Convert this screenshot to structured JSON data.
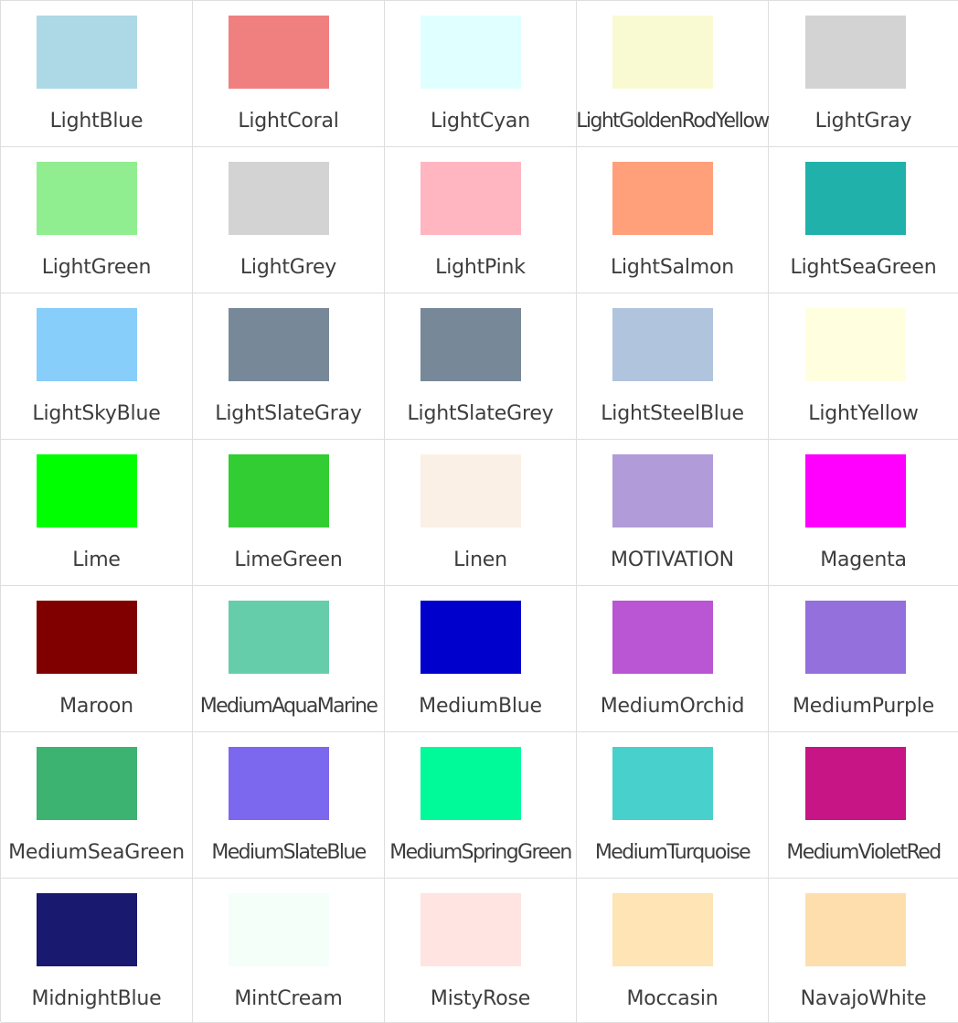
{
  "colors": [
    {
      "name": "LightBlue",
      "hex": "#ADD8E6"
    },
    {
      "name": "LightCoral",
      "hex": "#F08080"
    },
    {
      "name": "LightCyan",
      "hex": "#E0FFFF"
    },
    {
      "name": "LightGoldenRodYellow",
      "hex": "#FAFAD2"
    },
    {
      "name": "LightGray",
      "hex": "#D3D3D3"
    },
    {
      "name": "LightGreen",
      "hex": "#90EE90"
    },
    {
      "name": "LightGrey",
      "hex": "#D3D3D3"
    },
    {
      "name": "LightPink",
      "hex": "#FFB6C1"
    },
    {
      "name": "LightSalmon",
      "hex": "#FFA07A"
    },
    {
      "name": "LightSeaGreen",
      "hex": "#20B2AA"
    },
    {
      "name": "LightSkyBlue",
      "hex": "#87CEFA"
    },
    {
      "name": "LightSlateGray",
      "hex": "#778899"
    },
    {
      "name": "LightSlateGrey",
      "hex": "#778899"
    },
    {
      "name": "LightSteelBlue",
      "hex": "#B0C4DE"
    },
    {
      "name": "LightYellow",
      "hex": "#FFFFE0"
    },
    {
      "name": "Lime",
      "hex": "#00FF00"
    },
    {
      "name": "LimeGreen",
      "hex": "#32CD32"
    },
    {
      "name": "Linen",
      "hex": "#FAF0E6"
    },
    {
      "name": "MOTIVATION",
      "hex": "#B19CD9"
    },
    {
      "name": "Magenta",
      "hex": "#FF00FF"
    },
    {
      "name": "Maroon",
      "hex": "#800000"
    },
    {
      "name": "MediumAquaMarine",
      "hex": "#66CDAA"
    },
    {
      "name": "MediumBlue",
      "hex": "#0000CD"
    },
    {
      "name": "MediumOrchid",
      "hex": "#BA55D3"
    },
    {
      "name": "MediumPurple",
      "hex": "#9370DB"
    },
    {
      "name": "MediumSeaGreen",
      "hex": "#3CB371"
    },
    {
      "name": "MediumSlateBlue",
      "hex": "#7B68EE"
    },
    {
      "name": "MediumSpringGreen",
      "hex": "#00FA9A"
    },
    {
      "name": "MediumTurquoise",
      "hex": "#48D1CC"
    },
    {
      "name": "MediumVioletRed",
      "hex": "#C71585"
    },
    {
      "name": "MidnightBlue",
      "hex": "#191970"
    },
    {
      "name": "MintCream",
      "hex": "#F5FFFA"
    },
    {
      "name": "MistyRose",
      "hex": "#FFE4E1"
    },
    {
      "name": "Moccasin",
      "hex": "#FFE4B5"
    },
    {
      "name": "NavajoWhite",
      "hex": "#FFDEAD"
    }
  ]
}
